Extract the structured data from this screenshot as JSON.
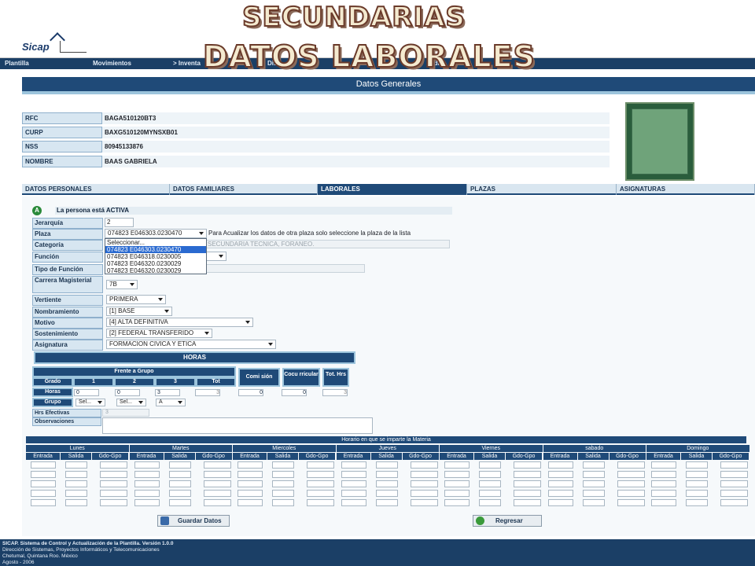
{
  "overlay": {
    "title_line1": "SECUNDARIAS",
    "title_line2": "DATOS LABORALES"
  },
  "header": {
    "logo_text": "Sicap"
  },
  "nav": [
    {
      "label": "Plantilla"
    },
    {
      "label": "Movimientos"
    },
    {
      "label": "> Inventa"
    },
    {
      "label": "Dis"
    },
    {
      "label": "Adm"
    }
  ],
  "section_title": "Datos Generales",
  "general": {
    "rfc_label": "RFC",
    "rfc": "BAGA510120BT3",
    "curp_label": "CURP",
    "curp": "BAXG510120MYNSXB01",
    "nss_label": "NSS",
    "nss": "80945133876",
    "nombre_label": "NOMBRE",
    "nombre": "BAAS GABRIELA"
  },
  "tabs": [
    {
      "label": "DATOS PERSONALES"
    },
    {
      "label": "DATOS FAMILIARES"
    },
    {
      "label": "LABORALES"
    },
    {
      "label": "PLAZAS"
    },
    {
      "label": "ASIGNATURAS"
    }
  ],
  "laborales": {
    "status_letter": "A",
    "status_text": "La persona está ACTIVA",
    "jerarquia_label": "Jerarquía",
    "jerarquia": "2",
    "plaza_label": "Plaza",
    "plaza": "074823 E046303.0230470",
    "plaza_hint": "Para Acualizar los datos de otra plaza solo seleccione la plaza de la lista",
    "plaza_options": [
      "Seleccionar...",
      "074823 E046303.0230470",
      "074823 E046318.0230005",
      "074823 E046320.0230029",
      "074823 E046320.0230029"
    ],
    "categoria_label": "Categoría",
    "categoria": "SECUNDARIA TECNICA, FORANEO.",
    "funcion_label": "Función",
    "tipo_funcion_label": "Tipo de Función",
    "carrera_label": "Carrera Magisterial",
    "carrera": "7B",
    "vertiente_label": "Vertiente",
    "vertiente": "PRIMERA",
    "nombramiento_label": "Nombramiento",
    "nombramiento": "[1] BASE",
    "motivo_label": "Motivo",
    "motivo": "[4] ALTA DEFINITIVA",
    "sostenimiento_label": "Sostenimiento",
    "sostenimiento": "[2] FEDERAL TRANSFERIDO",
    "asignatura_label": "Asignatura",
    "asignatura": "FORMACION CIVICA Y ETICA"
  },
  "horas": {
    "title": "HORAS",
    "frente": "Frente a Grupo",
    "comision": "Comi sión",
    "cocurricular": "Cocu rricular",
    "tot_hrs": "Tot. Hrs",
    "grado_label": "Grado",
    "g1": "1",
    "g2": "2",
    "g3": "3",
    "tot": "Tot",
    "horas_label": "Horas",
    "h1": "0",
    "h2": "0",
    "h3": "3",
    "htot": "3",
    "hcom": "0",
    "hcoc": "0",
    "htotal": "3",
    "grupo_label": "Grupo",
    "sel1": "Sel...",
    "sel2": "Sel...",
    "sel3": "A",
    "efectivas_label": "Hrs Efectivas",
    "efectivas": "3",
    "observaciones_label": "Observaciones"
  },
  "schedule": {
    "title": "Horario en que se imparte la Materia",
    "days": [
      "Lunes",
      "Martes",
      "Miercoles",
      "Jueves",
      "Viernes",
      "sabado",
      "Domingo"
    ],
    "sub": [
      "Entrada",
      "Salida",
      "Gdo-Gpo"
    ]
  },
  "buttons": {
    "save": "Guardar Datos",
    "back": "Regresar"
  },
  "footer": {
    "line1": "SICAP. Sistema de Control y Actualización de la Plantilla. Versión 1.0.0",
    "line2": "Dirección de Sistemas, Proyectos Informáticos y Telecomunicaciones",
    "line3": "Chetumal, Quintana Roo. México",
    "line4": "Agosto - 2006"
  }
}
